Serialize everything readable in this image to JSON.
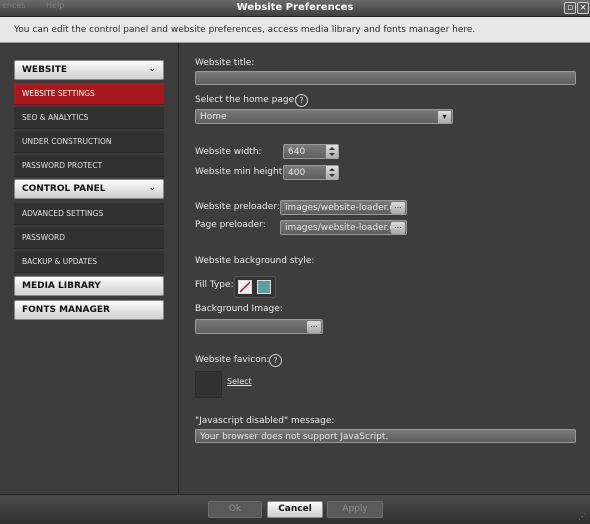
{
  "window": {
    "title": "Website Preferences",
    "ghost_menu": [
      "ences",
      "Help"
    ]
  },
  "info_text": "You can edit the control panel and website preferences, access media library and fonts manager here.",
  "sidebar": {
    "website": {
      "label": "WEBSITE",
      "items": [
        {
          "label": "WEBSITE SETTINGS",
          "active": true
        },
        {
          "label": "SEO & ANALYTICS"
        },
        {
          "label": "UNDER CONSTRUCTION"
        },
        {
          "label": "PASSWORD PROTECT"
        }
      ]
    },
    "control_panel": {
      "label": "CONTROL PANEL",
      "items": [
        {
          "label": "ADVANCED SETTINGS"
        },
        {
          "label": "PASSWORD"
        },
        {
          "label": "BACKUP & UPDATES"
        }
      ]
    },
    "media_library": {
      "label": "MEDIA LIBRARY"
    },
    "fonts_manager": {
      "label": "FONTS MANAGER"
    }
  },
  "form": {
    "website_title": {
      "label": "Website title:",
      "value": ""
    },
    "home_page": {
      "label": "Select the home page:",
      "value": "Home"
    },
    "website_width": {
      "label": "Website width:",
      "value": "640"
    },
    "website_min_height": {
      "label": "Website min height:",
      "value": "400"
    },
    "website_preloader": {
      "label": "Website preloader:",
      "value": "images/website-loader.gif"
    },
    "page_preloader": {
      "label": "Page preloader:",
      "value": "images/website-loader.gif"
    },
    "background_style": {
      "label": "Website background style:"
    },
    "fill_type": {
      "label": "Fill Type:"
    },
    "background_image": {
      "label": "Background Image:",
      "value": ""
    },
    "favicon": {
      "label": "Website favicon:",
      "select_label": "Select"
    },
    "js_disabled": {
      "label": "\"Javascript disabled\" message:",
      "value": "Your browser does not support JavaScript."
    },
    "browse_glyph": "..."
  },
  "footer": {
    "ok": "Ok",
    "cancel": "Cancel",
    "apply": "Apply"
  },
  "colors": {
    "accent_red": "#a8191f",
    "fill_teal": "#5f9e9a"
  }
}
